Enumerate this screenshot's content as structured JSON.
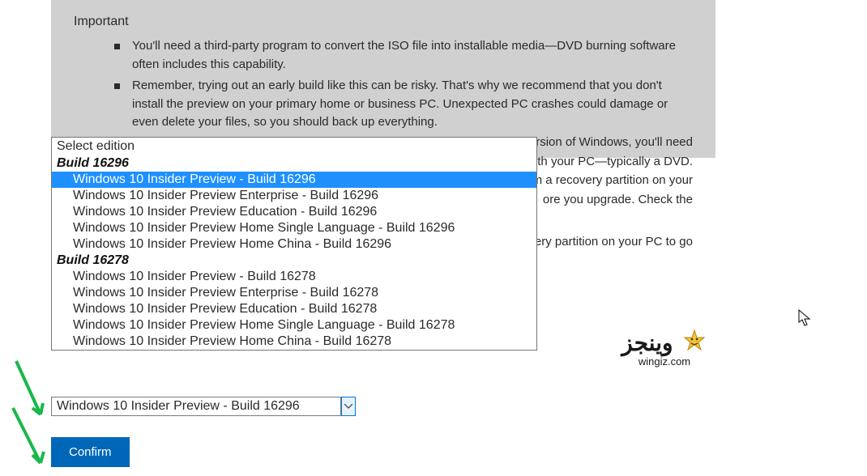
{
  "important": {
    "heading": "Important",
    "bullets": [
      "You'll need a third-party program to convert the ISO file into installable media—DVD burning software often includes this capability.",
      "Remember, trying out an early build like this can be risky. That's why we recommend that you don't install the preview on your primary home or business PC. Unexpected PC crashes could damage or even delete your files, so you should back up everything."
    ]
  },
  "bg_fragments": {
    "f1": "us version of Windows, you'll need",
    "f2": "me with your PC—typically a DVD.",
    "f3": "om a recovery partition on your",
    "f4": "ore you upgrade. Check the",
    "f5": "ery partition on your PC to go"
  },
  "dropdown": {
    "placeholder": "Select edition",
    "groups": [
      {
        "label": "Build 16296",
        "items": [
          {
            "label": "Windows 10 Insider Preview - Build 16296",
            "selected": true
          },
          {
            "label": "Windows 10 Insider Preview Enterprise - Build 16296"
          },
          {
            "label": "Windows 10 Insider Preview Education - Build 16296"
          },
          {
            "label": "Windows 10 Insider Preview Home Single Language - Build 16296"
          },
          {
            "label": "Windows 10 Insider Preview Home China - Build 16296"
          }
        ]
      },
      {
        "label": "Build 16278",
        "items": [
          {
            "label": "Windows 10 Insider Preview - Build 16278"
          },
          {
            "label": "Windows 10 Insider Preview Enterprise - Build 16278"
          },
          {
            "label": "Windows 10 Insider Preview Education - Build 16278"
          },
          {
            "label": "Windows 10 Insider Preview Home Single Language - Build 16278"
          },
          {
            "label": "Windows 10 Insider Preview Home China - Build 16278"
          }
        ]
      }
    ]
  },
  "select": {
    "value": "Windows 10 Insider Preview - Build 16296"
  },
  "confirm": {
    "label": "Confirm"
  },
  "wingiz": {
    "ar": "وينجز",
    "sub": "wingiz.com"
  }
}
